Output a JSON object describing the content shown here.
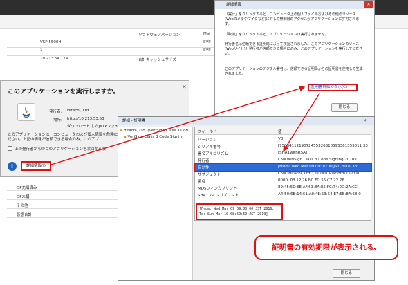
{
  "background_app": {
    "table": {
      "header_cells": [
        "ソフトウェアバージョン",
        "Mai"
      ],
      "rows": [
        {
          "value": "VSP 5500H",
          "right": "SVP"
        },
        {
          "value": "1",
          "right": "SVP"
        },
        {
          "value": "10.213.54.174",
          "mid": "合計キャッシュサイズ",
          "right": ""
        }
      ]
    },
    "list_items": [
      "DP充填済み",
      "DP未構",
      "その他",
      "仮想合計"
    ]
  },
  "java_dialog": {
    "title": "このアプリケーションを実行しますか。",
    "publisher_label": "発行者:",
    "publisher_value": "Hitachi, Ltd.",
    "location_label": "場所:",
    "location_value": "http://10.213.53.53",
    "download_note": "ダウンロード したJNLPファイ",
    "warning_text_1": "このアプリケーションは、コンピュータおよび個人情報を危険にさら",
    "warning_text_2": "ださい。上記の情報が信頼できる場合のみ、このアプ",
    "checkbox_label": "上の発行者からのこのアプリケーションを次回から表",
    "more_info_label": "詳細情報(I)"
  },
  "details_dialog": {
    "title": "詳細情報",
    "para1": "「実行」をクリックすると、コンピュータ上の個人ファイルおよびその他のリソース(Webカメラやマイクなど)に対して無制限のアクセスがアプリケーションに許可されます。",
    "para2": "「取消」をクリックすると、アプリケーションは実行されません。",
    "para3": "発行者名は信頼できる証明局によって検証されました。このアプリケーションのソース(Webサイト)と発行者が信頼できる場合にのみ、このアプリケーションを実行してください。",
    "para4": "このアプリケーションのデジタル署名は、信頼できる証明局からの証明書を使用して生成されました。",
    "cert_link": "証明書詳細の表示(C)",
    "close_button": "閉じる"
  },
  "cert_dialog": {
    "title": "詳細 - 証明書",
    "tree_items": [
      "Hitachi, Ltd. (VeriSign Class 3 Cod",
      "VeriSign Class 3 Code Signin"
    ],
    "col_field": "フィールド",
    "col_value": "値",
    "rows": [
      {
        "field": "バージョン",
        "value": "V3"
      },
      {
        "field": "シリアル番号",
        "value": "[7503411219072455326310595361353011 33"
      },
      {
        "field": "署名アルゴリズム",
        "value": "[SHA1withRSA]"
      },
      {
        "field": "発行者",
        "value": "CN=VeriSign Class 3 Code Signing 2010 C"
      },
      {
        "field": "有効性",
        "value": "[From: Wed Mar 09 09:00:00 JST 2016, To:"
      },
      {
        "field": "サブジェクト",
        "value": "CN=\"Hitachi, Ltd.\", OU=IT Platform Divisio"
      },
      {
        "field": "署名",
        "value": "0000: 03 12 26 BC FD 55 C7 22 26"
      },
      {
        "field": "MD5フィンガプリント",
        "value": "89:45:5C:3E:AF:63:8A:E5:FC:74:0D:2A:CC"
      },
      {
        "field": "SHA1フィンガプリント",
        "value": "A4:50:6B:14:51:A0:4E:53:54:E7:5B:8A:68:0"
      }
    ],
    "validity_line1": "[From: Wed Mar 09 09:00:00 JST 2016,",
    "validity_line2": " To: Sun Mar 10 08:59:59 JST 2019]",
    "close_button": "閉じる"
  },
  "callout_text": "証明書の有効期限が表示される。",
  "colors": {
    "annotation_red": "#e01010",
    "selection_blue": "#2f6bd6",
    "info_blue": "#1f5fbf"
  }
}
